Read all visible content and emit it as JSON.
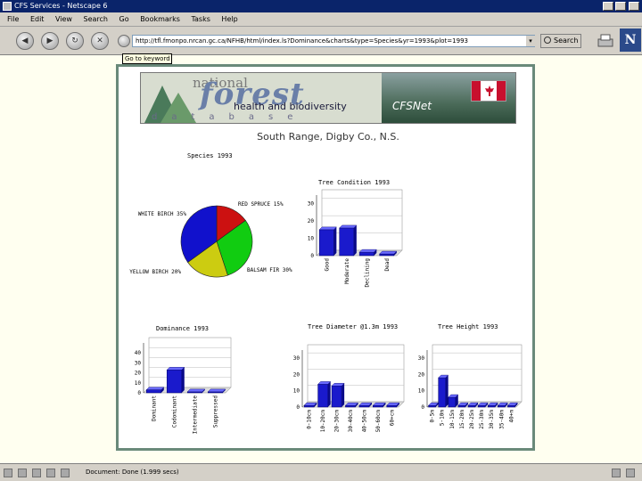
{
  "window": {
    "title": "CFS Services - Netscape 6"
  },
  "menubar": {
    "items": [
      "File",
      "Edit",
      "View",
      "Search",
      "Go",
      "Bookmarks",
      "Tasks",
      "Help"
    ]
  },
  "toolbar": {
    "url": "http://tfl.fmonpo.nrcan.gc.ca/NFHB/html/index.ls?Dominance&charts&type=Species&yr=1993&plot=1993",
    "search_label": "Search",
    "tooltip": "Go to keyword"
  },
  "page": {
    "banner": {
      "national": "national",
      "forest": "forest",
      "subtitle": "health and biodiversity",
      "database": "database",
      "cfsnet": "CFSNet"
    },
    "heading": "South Range, Digby Co., N.S."
  },
  "status": {
    "text": "Document: Done (1.999 secs)"
  },
  "chart_data": [
    {
      "type": "pie",
      "title": "Species 1993",
      "labels": [
        "RED SPRUCE",
        "WHITE BIRCH",
        "YELLOW BIRCH",
        "BALSAM FIR"
      ],
      "values": [
        15,
        35,
        20,
        30
      ],
      "colors": [
        "#cc1111",
        "#1111cc",
        "#cccc11",
        "#11cc11"
      ],
      "label_text": [
        "RED SPRUCE 15%",
        "WHITE BIRCH 35%",
        "YELLOW BIRCH 20%",
        "BALSAM FIR 30%"
      ]
    },
    {
      "type": "bar",
      "title": "Tree Condition 1993",
      "categories": [
        "Good",
        "Moderate",
        "Declining",
        "Dead"
      ],
      "values": [
        15,
        16,
        2,
        1
      ],
      "yticks": [
        0,
        10,
        20,
        30
      ],
      "ylim": [
        0,
        35
      ],
      "color": "#1a1acc"
    },
    {
      "type": "bar",
      "title": "Dominance 1993",
      "categories": [
        "Dominant",
        "Codominant",
        "Intermediate",
        "Suppressed"
      ],
      "values": [
        3,
        23,
        1,
        1
      ],
      "yticks": [
        0,
        10,
        20,
        30,
        40
      ],
      "ylim": [
        0,
        50
      ],
      "color": "#1a1acc"
    },
    {
      "type": "bar",
      "title": "Tree Diameter @1.3m 1993",
      "categories": [
        "0-10cm",
        "10-20cm",
        "20-30cm",
        "30-40cm",
        "40-50cm",
        "50-60cm",
        "60+cm"
      ],
      "values": [
        1,
        14,
        13,
        1,
        1,
        1,
        1
      ],
      "yticks": [
        0,
        10,
        20,
        30
      ],
      "ylim": [
        0,
        35
      ],
      "color": "#1a1acc"
    },
    {
      "type": "bar",
      "title": "Tree Height 1993",
      "categories": [
        "0-5m",
        "5-10m",
        "10-15m",
        "15-20m",
        "20-25m",
        "25-30m",
        "30-35m",
        "35-40m",
        "40+m"
      ],
      "values": [
        1,
        18,
        6,
        1,
        1,
        1,
        1,
        1,
        1
      ],
      "yticks": [
        0,
        10,
        20,
        30
      ],
      "ylim": [
        0,
        35
      ],
      "color": "#1a1acc"
    }
  ]
}
